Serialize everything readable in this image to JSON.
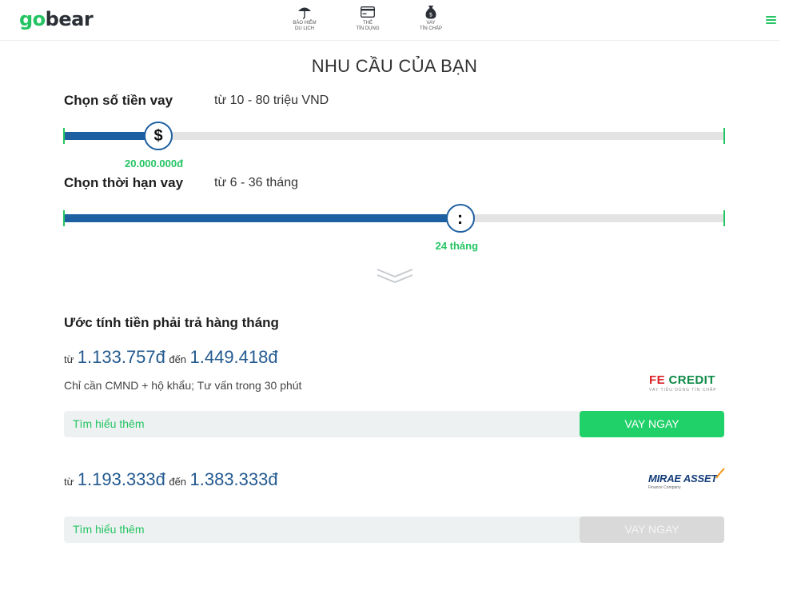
{
  "header": {
    "logo_go": "go",
    "logo_bear": "bear",
    "nav": [
      {
        "label": "BẢO HIỂM\nDU LỊCH",
        "icon": "umbrella-icon"
      },
      {
        "label": "THẺ\nTÍN DỤNG",
        "icon": "credit-card-icon"
      },
      {
        "label": "VAY\nTÍN CHẤP",
        "icon": "money-bag-icon"
      }
    ],
    "menu_icon": "hamburger-menu-icon"
  },
  "section_title": "NHU CẦU CỦA BẠN",
  "loan_amount": {
    "label": "Chọn số tiền vay",
    "range_text": "từ 10 - 80 triệu VND",
    "thumb_symbol": "$",
    "value_text": "20.000.000đ",
    "min": 10000000,
    "max": 80000000,
    "value": 20000000
  },
  "loan_term": {
    "label": "Chọn thời hạn vay",
    "range_text": "từ 6 - 36 tháng",
    "thumb_symbol": ":",
    "value_text": "24 tháng",
    "min": 6,
    "max": 36,
    "value": 24
  },
  "estimate_title": "Ước tính tiền phải trả hàng tháng",
  "offers": [
    {
      "from_word": "từ",
      "from_amount": "1.133.757đ",
      "to_word": "đến",
      "to_amount": "1.449.418đ",
      "description": "Chỉ cần CMND + hộ khẩu; Tư vấn trong 30 phút",
      "learn_more": "Tìm hiểu thêm",
      "cta": "VAY NGAY",
      "cta_enabled": true,
      "logo_part1": "FE",
      "logo_part2": "CREDIT",
      "logo_tagline": "VAY TIÊU DÙNG TÍN CHẤP"
    },
    {
      "from_word": "từ",
      "from_amount": "1.193.333đ",
      "to_word": "đến",
      "to_amount": "1.383.333đ",
      "learn_more": "Tìm hiểu thêm",
      "cta": "VAY NGAY",
      "cta_enabled": false,
      "logo_name": "MIRAE ASSET",
      "logo_tagline": "Finance Company"
    }
  ],
  "colors": {
    "brand_green": "#24c463",
    "slider_fill": "#1d5fa0",
    "amount_blue": "#245a8f",
    "cta_green": "#1fd168",
    "cta_disabled": "#d9d9d9"
  }
}
